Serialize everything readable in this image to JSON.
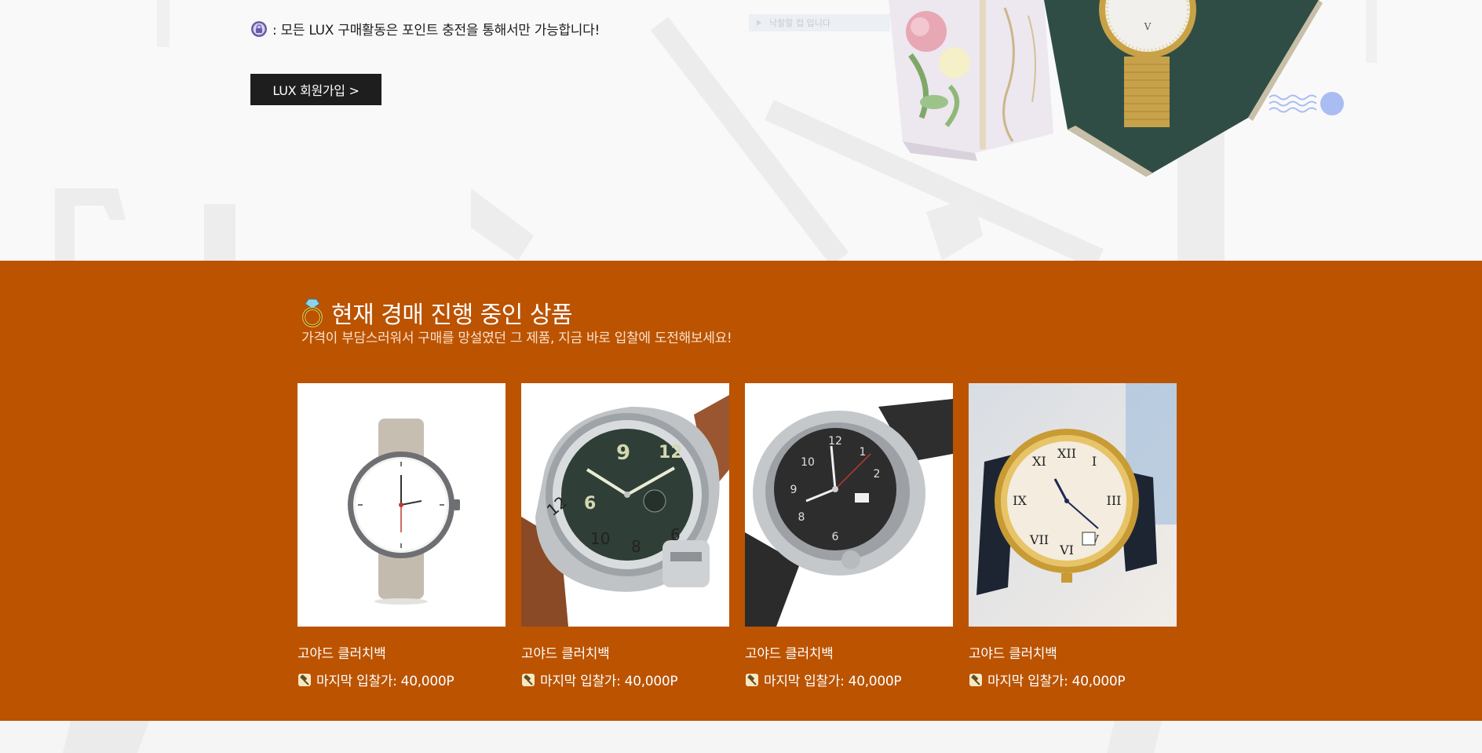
{
  "hero": {
    "notice_icon": "lock-badge-icon",
    "notice_text": ": 모든 LUX 구매활동은 포인트 충전을 통해서만 가능합니다!",
    "join_button_label": "LUX 회원가입  >",
    "search_placeholder": "낙찰할 컵 입니다",
    "art_icon": "gift-box-watch-illustration",
    "wave_icon": "wave-decoration-icon"
  },
  "auction": {
    "title_icon": "ring-icon",
    "title": "현재 경매 진행 중인 상품",
    "subtitle": "가격이 부담스러워서 구매를 망설였던 그 제품, 지금 바로 입찰에 도전해보세요!",
    "bid_icon": "hammer-icon",
    "products": [
      {
        "name": "고야드 클러치백",
        "bid": "마지막 입찰가: 40,000P",
        "image": "minimal-white-dial-watch"
      },
      {
        "name": "고야드 클러치백",
        "bid": "마지막 입찰가: 40,000P",
        "image": "panerai-green-dial-watch"
      },
      {
        "name": "고야드 클러치백",
        "bid": "마지막 입찰가: 40,000P",
        "image": "seiko-black-dial-watch"
      },
      {
        "name": "고야드 클러치백",
        "bid": "마지막 입찰가: 40,000P",
        "image": "gold-roman-dial-watch"
      }
    ]
  },
  "colors": {
    "auction_bg": "#bb5300",
    "button_bg": "#1e1e1e",
    "subtitle_color": "#fbe1cc",
    "accent_blue": "#a9bdf2"
  }
}
